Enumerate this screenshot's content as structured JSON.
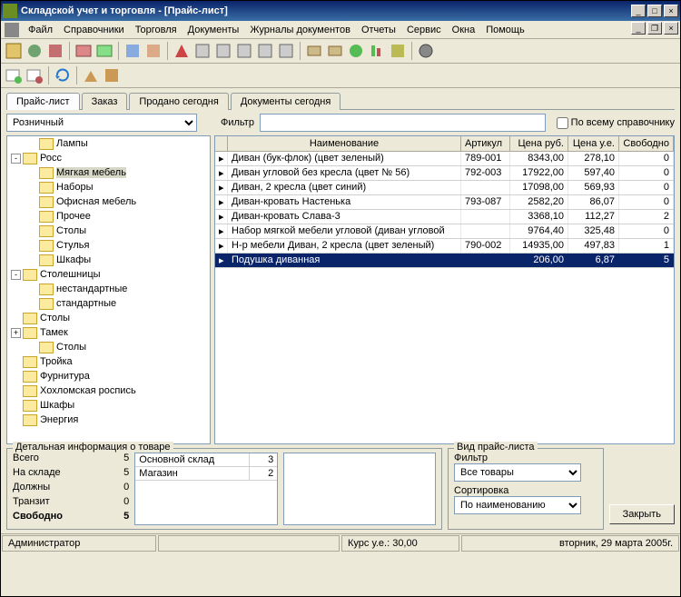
{
  "title": "Складской учет и торговля - [Прайс-лист]",
  "menu": [
    "Файл",
    "Справочники",
    "Торговля",
    "Документы",
    "Журналы документов",
    "Отчеты",
    "Сервис",
    "Окна",
    "Помощь"
  ],
  "tabs": [
    "Прайс-лист",
    "Заказ",
    "Продано сегодня",
    "Документы сегодня"
  ],
  "activeTab": 0,
  "priceType": "Розничный",
  "filterLabel": "Фильтр",
  "filterValue": "",
  "fullDirLabel": "По всему справочнику",
  "tree": [
    {
      "d": 1,
      "e": "",
      "t": "Лампы"
    },
    {
      "d": 0,
      "e": "-",
      "t": "Росс"
    },
    {
      "d": 1,
      "e": "",
      "t": "Мягкая мебель",
      "sel": true
    },
    {
      "d": 1,
      "e": "",
      "t": "Наборы"
    },
    {
      "d": 1,
      "e": "",
      "t": "Офисная мебель"
    },
    {
      "d": 1,
      "e": "",
      "t": "Прочее"
    },
    {
      "d": 1,
      "e": "",
      "t": "Столы"
    },
    {
      "d": 1,
      "e": "",
      "t": "Стулья"
    },
    {
      "d": 1,
      "e": "",
      "t": "Шкафы"
    },
    {
      "d": 0,
      "e": "-",
      "t": "Столешницы"
    },
    {
      "d": 1,
      "e": "",
      "t": "нестандартные"
    },
    {
      "d": 1,
      "e": "",
      "t": "стандартные"
    },
    {
      "d": 0,
      "e": "",
      "t": "Столы"
    },
    {
      "d": 0,
      "e": "+",
      "t": "Тамек"
    },
    {
      "d": 1,
      "e": "",
      "t": "Столы"
    },
    {
      "d": 0,
      "e": "",
      "t": "Тройка"
    },
    {
      "d": 0,
      "e": "",
      "t": "Фурнитура"
    },
    {
      "d": 0,
      "e": "",
      "t": "Хохломская роспись"
    },
    {
      "d": 0,
      "e": "",
      "t": "Шкафы"
    },
    {
      "d": 0,
      "e": "",
      "t": "Энергия"
    }
  ],
  "gridHeaders": [
    "",
    "Наименование",
    "Артикул",
    "Цена руб.",
    "Цена у.е.",
    "Свободно"
  ],
  "gridRows": [
    {
      "n": "Диван (бук-флок) (цвет зеленый)",
      "a": "789-001",
      "pr": "8343,00",
      "pu": "278,10",
      "f": "0"
    },
    {
      "n": "Диван угловой без кресла (цвет № 56)",
      "a": "792-003",
      "pr": "17922,00",
      "pu": "597,40",
      "f": "0"
    },
    {
      "n": "Диван, 2 кресла (цвет синий)",
      "a": "",
      "pr": "17098,00",
      "pu": "569,93",
      "f": "0"
    },
    {
      "n": "Диван-кровать Настенька",
      "a": "793-087",
      "pr": "2582,20",
      "pu": "86,07",
      "f": "0"
    },
    {
      "n": "Диван-кровать Слава-3",
      "a": "",
      "pr": "3368,10",
      "pu": "112,27",
      "f": "2"
    },
    {
      "n": "Набор мягкой мебели угловой (диван угловой",
      "a": "",
      "pr": "9764,40",
      "pu": "325,48",
      "f": "0"
    },
    {
      "n": "Н-р мебели Диван, 2 кресла (цвет зеленый)",
      "a": "790-002",
      "pr": "14935,00",
      "pu": "497,83",
      "f": "1"
    },
    {
      "n": "Подушка диванная",
      "a": "",
      "pr": "206,00",
      "pu": "6,87",
      "f": "5",
      "sel": true
    }
  ],
  "detail": {
    "title": "Детальная информация о товаре",
    "rows": [
      [
        "Всего",
        "5"
      ],
      [
        "На складе",
        "5"
      ],
      [
        "Должны",
        "0"
      ],
      [
        "Транзит",
        "0"
      ],
      [
        "Свободно",
        "5"
      ]
    ],
    "stocks": [
      [
        "Основной склад",
        "3"
      ],
      [
        "Магазин",
        "2"
      ]
    ]
  },
  "viewPanel": {
    "title": "Вид прайс-листа",
    "filterLabel": "Фильтр",
    "filterValue": "Все товары",
    "sortLabel": "Сортировка",
    "sortValue": "По наименованию"
  },
  "closeBtn": "Закрыть",
  "status": {
    "user": "Администратор",
    "rate": "Курс у.е.: 30,00",
    "date": "вторник, 29 марта 2005г."
  }
}
